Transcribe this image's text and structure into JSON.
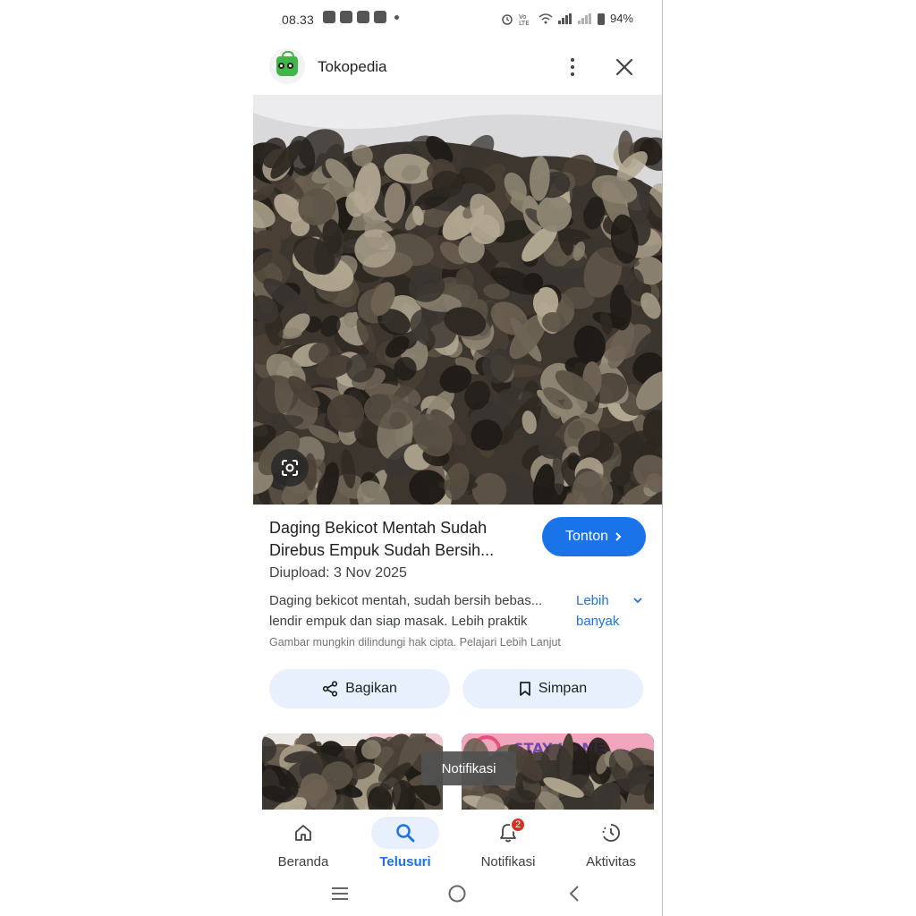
{
  "status_bar": {
    "time": "08.33",
    "battery": "94%"
  },
  "header": {
    "site_name": "Tokopedia"
  },
  "result": {
    "title": "Daging Bekicot Mentah Sudah Direbus Empuk Sudah Bersih...",
    "action_label": "Tonton",
    "upload_date": "Diupload: 3 Nov 2025",
    "description": "Daging bekicot mentah, sudah bersih bebas... lendir empuk dan siap masak. Lebih praktik",
    "more_label": "Lebih banyak",
    "copyright_note": "Gambar mungkin dilindungi hak cipta. Pelajari Lebih Lanjut"
  },
  "actions": {
    "share_label": "Bagikan",
    "save_label": "Simpan"
  },
  "related": {
    "thumb2_overlay": "STAY HOME"
  },
  "tooltip": "Notifikasi",
  "bottom_nav": {
    "items": [
      {
        "label": "Beranda",
        "icon": "home-icon",
        "active": false
      },
      {
        "label": "Telusuri",
        "icon": "search-icon",
        "active": true
      },
      {
        "label": "Notifikasi",
        "icon": "bell-icon",
        "active": false,
        "badge": "2"
      },
      {
        "label": "Aktivitas",
        "icon": "activity-icon",
        "active": false
      }
    ]
  },
  "colors": {
    "accent": "#1a73e8",
    "pill_bg": "#e8f0fe",
    "badge": "#d93025"
  }
}
